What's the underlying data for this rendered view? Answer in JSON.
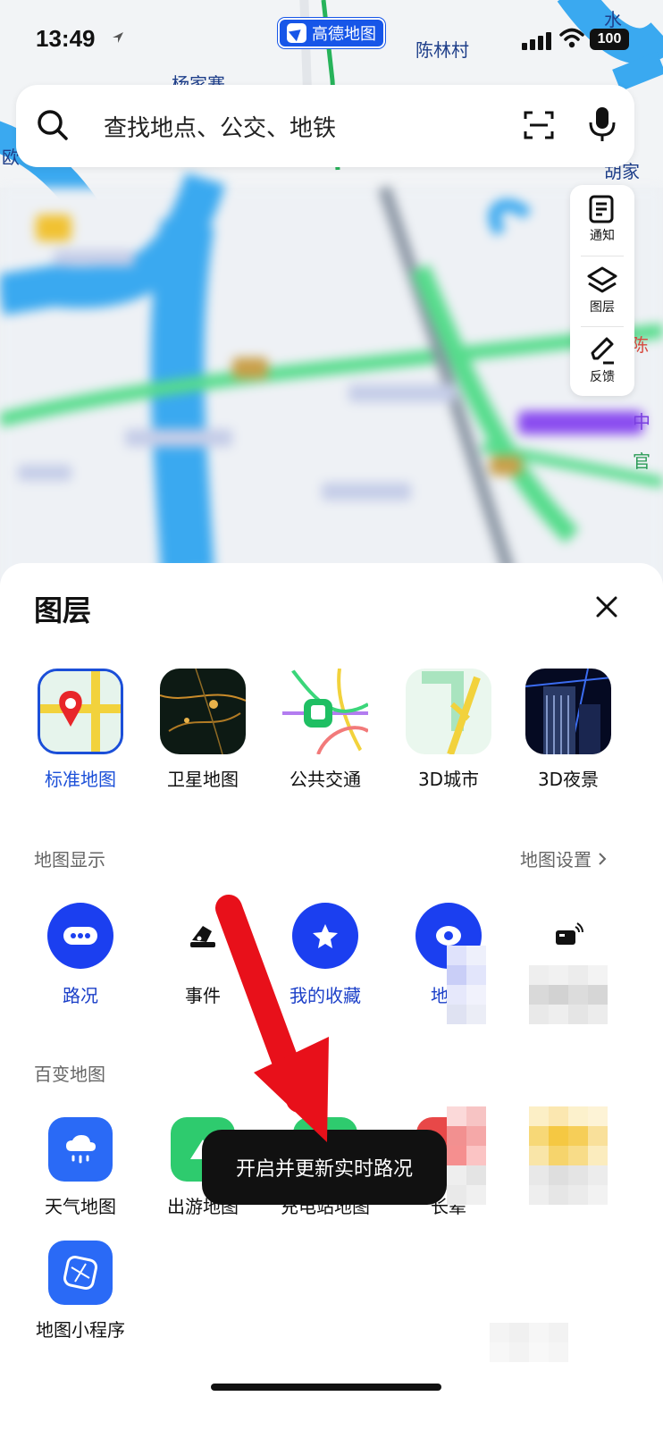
{
  "status": {
    "time": "13:49",
    "battery": "100",
    "app_badge": "高德地图"
  },
  "map": {
    "place_labels": [
      "陈林村",
      "杨家寨",
      "水",
      "欧",
      "胡家",
      "中",
      "官",
      "陈"
    ],
    "colors": {
      "river": "#3aa9f0",
      "subway": "#47d37a",
      "purple_line": "#8a4cf0"
    }
  },
  "search": {
    "placeholder": "查找地点、公交、地铁",
    "icons": [
      "search-icon",
      "scan-icon",
      "mic-icon"
    ]
  },
  "tools": [
    {
      "label": "通知",
      "icon": "notice-icon"
    },
    {
      "label": "图层",
      "icon": "layers-icon"
    },
    {
      "label": "反馈",
      "icon": "feedback-icon"
    }
  ],
  "sheet": {
    "title": "图层",
    "layers": [
      {
        "label": "标准地图",
        "selected": true
      },
      {
        "label": "卫星地图",
        "selected": false
      },
      {
        "label": "公共交通",
        "selected": false
      },
      {
        "label": "3D城市",
        "selected": false
      },
      {
        "label": "3D夜景",
        "selected": false
      }
    ],
    "display_section": "地图显示",
    "map_settings": "地图设置",
    "display_items": [
      {
        "label": "路况",
        "icon": "traffic-icon"
      },
      {
        "label": "事件",
        "icon": "event-icon"
      },
      {
        "label": "我的收藏",
        "icon": "star-icon"
      },
      {
        "label": "地点",
        "icon": "place-icon"
      },
      {
        "label": "",
        "icon": "device-icon"
      }
    ],
    "variety_section": "百变地图",
    "variety_items": [
      {
        "label": "天气地图",
        "icon": "weather-icon"
      },
      {
        "label": "出游地图",
        "icon": "travel-icon"
      },
      {
        "label": "充电站地图",
        "icon": "charging-icon"
      },
      {
        "label": "长辈",
        "icon": "elder-icon"
      },
      {
        "label": "",
        "icon": "blurred-icon"
      }
    ],
    "mini_program": {
      "label": "地图小程序",
      "icon": "mini-program-icon"
    },
    "toast": "开启并更新实时路况"
  },
  "colors": {
    "accent": "#1b3ff0",
    "selected_text": "#1b4fd8",
    "annotation_arrow": "#e8101a"
  }
}
